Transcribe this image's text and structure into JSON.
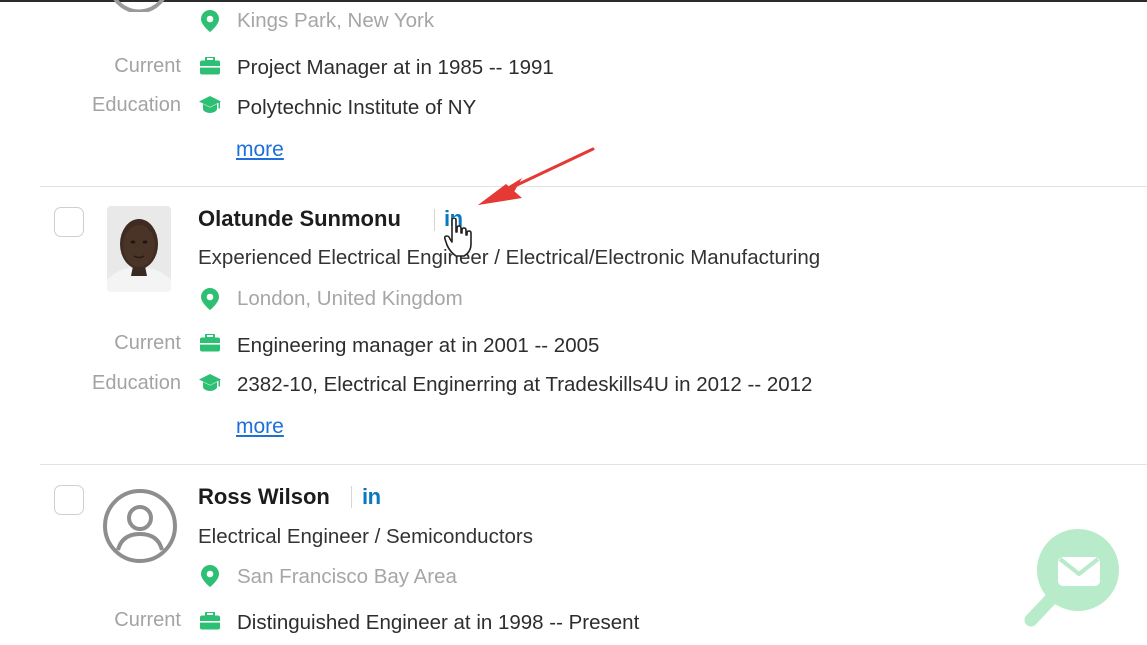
{
  "labels": {
    "current": "Current",
    "education": "Education"
  },
  "more_label": "more",
  "linkedin_label": "in",
  "colors": {
    "accent_green": "#2dbf73",
    "linkedin_blue": "#0a78be",
    "link_blue": "#1e6fd9",
    "arrow_red": "#e53935",
    "fab_green": "#b7ebc9"
  },
  "profiles": [
    {
      "location": "Kings Park, New York",
      "current": "Project Manager at in 1985 -- 1991",
      "education": "Polytechnic Institute of NY"
    },
    {
      "name": "Olatunde Sunmonu",
      "headline": "Experienced Electrical Engineer / Electrical/Electronic Manufacturing",
      "location": "London, United Kingdom",
      "current": "Engineering manager at in 2001 -- 2005",
      "education": "2382-10, Electrical Enginerring at Tradeskills4U in 2012 -- 2012"
    },
    {
      "name": "Ross Wilson",
      "headline": "Electrical Engineer / Semiconductors",
      "location": "San Francisco Bay Area",
      "current": "Distinguished Engineer at in 1998 -- Present"
    }
  ],
  "icons": {
    "location": "map-pin-icon",
    "current": "briefcase-icon",
    "education": "graduation-cap-icon",
    "fab": "message-search-icon",
    "annotation": "red-arrow-annotation",
    "cursor": "hand-pointer-cursor"
  }
}
